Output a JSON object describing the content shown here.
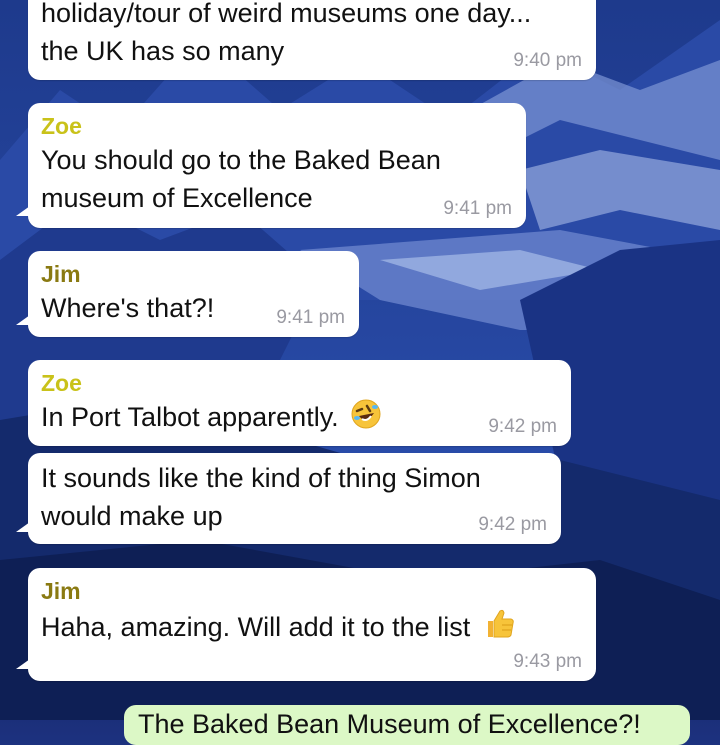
{
  "theme": {
    "zoe_color": "#c9c21a",
    "jim_color": "#8a7a12",
    "time_color": "#9a9aa2",
    "outgoing_color": "#dcf8c6"
  },
  "messages": [
    {
      "sender": "",
      "lines": [
        "holiday/tour of weird museums one day...",
        "the UK has so many"
      ],
      "time": "9:40 pm"
    },
    {
      "sender": "Zoe",
      "lines": [
        "You should go to the Baked Bean",
        "museum of Excellence"
      ],
      "time": "9:41 pm"
    },
    {
      "sender": "Jim",
      "lines": [
        "Where's that?!"
      ],
      "time": "9:41 pm"
    },
    {
      "sender": "Zoe",
      "lines": [
        "In Port Talbot apparently."
      ],
      "emoji": "rolling-on-floor-laughing-emoji",
      "time": "9:42 pm"
    },
    {
      "sender": "",
      "lines": [
        "It sounds like the kind of thing Simon",
        "would make up"
      ],
      "time": "9:42 pm"
    },
    {
      "sender": "Jim",
      "lines": [
        "Haha, amazing. Will add it to the list"
      ],
      "emoji": "thumbs-up-emoji",
      "time": "9:43 pm"
    }
  ],
  "outgoing_partial": "The Baked Bean Museum of Excellence?!"
}
